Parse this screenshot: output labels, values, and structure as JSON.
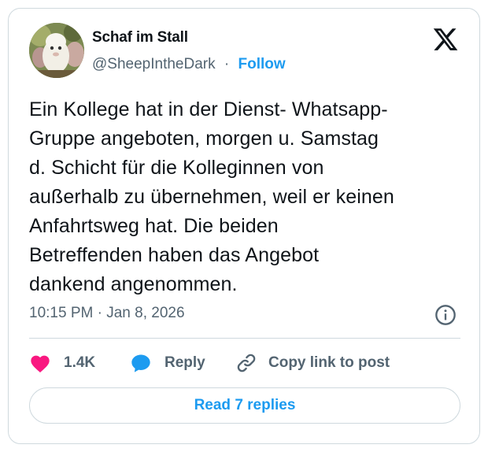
{
  "author": {
    "name": "Schaf im Stall",
    "handle": "@SheepIntheDark",
    "separator": "·",
    "follow_label": "Follow",
    "avatar_icon": "sheep-avatar"
  },
  "logo_icon": "x-logo-icon",
  "tweet": {
    "lines": [
      "Ein Kollege hat in der Dienst- Whatsapp-",
      "Gruppe angeboten, morgen u. Samstag",
      "d. Schicht für die Kolleginnen von",
      "außerhalb zu übernehmen, weil er keinen",
      "Anfahrtsweg hat. Die beiden",
      "Betreffenden haben das Angebot",
      "dankend angenommen."
    ],
    "timestamp": "10:15 PM · Jan 8, 2026"
  },
  "actions": {
    "like_count": "1.4K",
    "reply_label": "Reply",
    "copy_link_label": "Copy link to post",
    "read_replies_label": "Read 7 replies"
  },
  "colors": {
    "accent": "#1d9bf0",
    "heart": "#f91880",
    "muted_text": "#536471",
    "text": "#0f1419",
    "border": "#cfd9de"
  }
}
